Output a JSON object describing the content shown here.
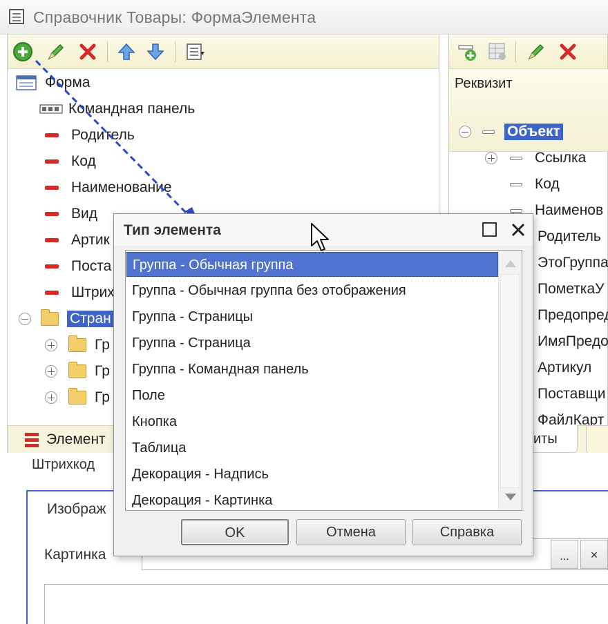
{
  "window": {
    "title": "Справочник Товары: ФормаЭлемента"
  },
  "left_tree": {
    "items": [
      {
        "label": "Форма",
        "icon": "form-icon"
      },
      {
        "label": "Командная панель",
        "icon": "command-bar-icon"
      },
      {
        "label": "Родитель",
        "icon": "field-icon"
      },
      {
        "label": "Код",
        "icon": "field-icon"
      },
      {
        "label": "Наименование",
        "icon": "field-icon"
      },
      {
        "label": "Вид",
        "icon": "field-icon"
      },
      {
        "label": "Артик",
        "icon": "field-icon"
      },
      {
        "label": "Поста",
        "icon": "field-icon"
      },
      {
        "label": "Штрих",
        "icon": "field-icon"
      },
      {
        "label": "Стран",
        "icon": "folder-icon",
        "selected": true
      },
      {
        "label": "Гр",
        "icon": "folder-icon"
      },
      {
        "label": "Гр",
        "icon": "folder-icon"
      },
      {
        "label": "Гр",
        "icon": "folder-icon"
      }
    ],
    "bottom_tab": "Элемент"
  },
  "right_pane": {
    "column_header": "Реквизит",
    "items": [
      {
        "label": "Объект",
        "selected": true
      },
      {
        "label": "Ссылка"
      },
      {
        "label": "Код"
      },
      {
        "label": "Наименов"
      },
      {
        "label": "Родитель"
      },
      {
        "label": "ЭтоГруппа"
      },
      {
        "label": "ПометкаУ"
      },
      {
        "label": "Предопред"
      },
      {
        "label": "ИмяПредо"
      },
      {
        "label": "Артикул"
      },
      {
        "label": "Поставщи"
      },
      {
        "label": "ФайлКарт"
      }
    ],
    "bottom_tab": "иты"
  },
  "lower_form": {
    "field1": "Штрихкод",
    "tab_label": "Изображ",
    "picture_label": "Картинка",
    "ellipsis": "...",
    "clear": "×"
  },
  "dialog": {
    "title": "Тип элемента",
    "options": [
      "Группа - Обычная группа",
      "Группа - Обычная группа без отображения",
      "Группа - Страницы",
      "Группа - Страница",
      "Группа - Командная панель",
      "Поле",
      "Кнопка",
      "Таблица",
      "Декорация - Надпись",
      "Декорация - Картинка"
    ],
    "selected_index": 0,
    "buttons": {
      "ok": "OK",
      "cancel": "Отмена",
      "help": "Справка"
    }
  },
  "colors": {
    "selection": "#4f73cf",
    "toolbar_bg": "#f5f1d6",
    "field_icon": "#d42a2a",
    "arrow": "#2b48c9"
  }
}
